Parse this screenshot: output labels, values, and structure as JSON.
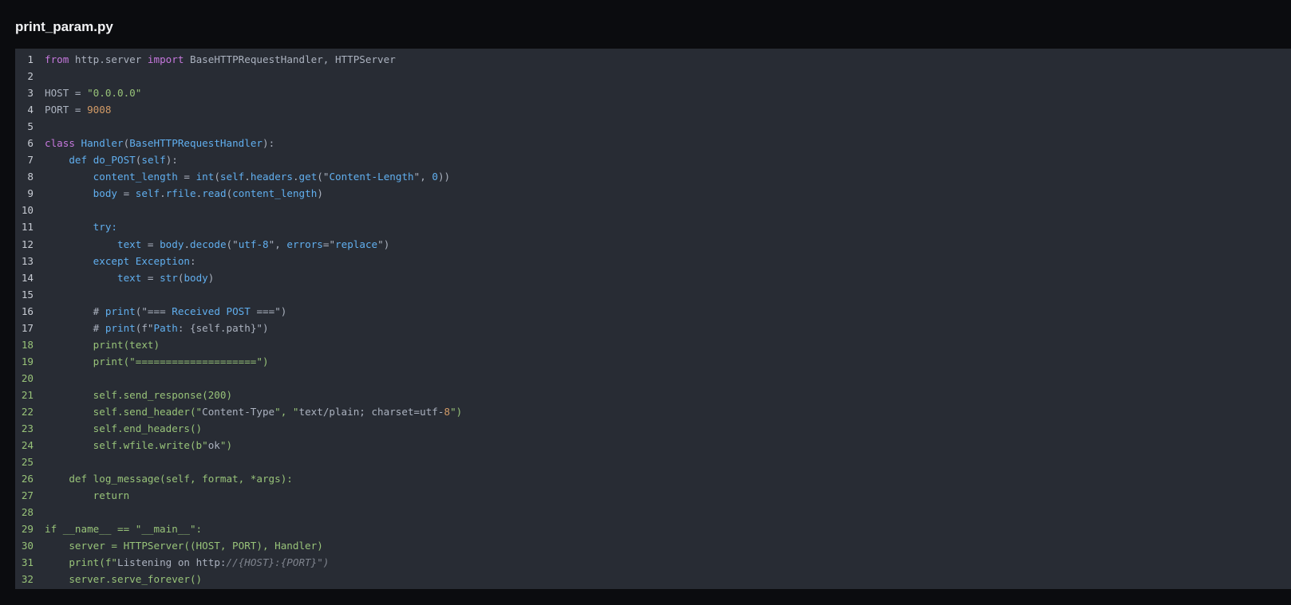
{
  "file": {
    "title": "print_param.py"
  },
  "colors": {
    "page_bg": "#0b0c0f",
    "panel_bg": "#282c34",
    "keyword": "#c678dd",
    "blue": "#61afef",
    "green": "#98c379",
    "orange": "#d19a66",
    "plain": "#abb2bf",
    "comment": "#7f848e"
  },
  "code": {
    "lines": [
      {
        "num": "1",
        "tokens": [
          {
            "t": "from",
            "c": "kw"
          },
          {
            "t": " http.server ",
            "c": "pl"
          },
          {
            "t": "import",
            "c": "kw"
          },
          {
            "t": " BaseHTTPRequestHandler, HTTPServer",
            "c": "pl"
          }
        ]
      },
      {
        "num": "2",
        "tokens": []
      },
      {
        "num": "3",
        "tokens": [
          {
            "t": "HOST = ",
            "c": "pl"
          },
          {
            "t": "\"0.0.0.0\"",
            "c": "gr"
          }
        ]
      },
      {
        "num": "4",
        "tokens": [
          {
            "t": "PORT = ",
            "c": "pl"
          },
          {
            "t": "9008",
            "c": "or"
          }
        ]
      },
      {
        "num": "5",
        "tokens": []
      },
      {
        "num": "6",
        "tokens": [
          {
            "t": "class",
            "c": "kw"
          },
          {
            "t": " ",
            "c": "pl"
          },
          {
            "t": "Handler",
            "c": "bl"
          },
          {
            "t": "(",
            "c": "pl"
          },
          {
            "t": "BaseHTTPRequestHandler",
            "c": "bl"
          },
          {
            "t": "):",
            "c": "pl"
          }
        ]
      },
      {
        "num": "7",
        "tokens": [
          {
            "t": "    ",
            "c": "pl"
          },
          {
            "t": "def",
            "c": "bl"
          },
          {
            "t": " ",
            "c": "pl"
          },
          {
            "t": "do_POST",
            "c": "bl"
          },
          {
            "t": "(",
            "c": "pl"
          },
          {
            "t": "self",
            "c": "bl"
          },
          {
            "t": "):",
            "c": "pl"
          }
        ]
      },
      {
        "num": "8",
        "tokens": [
          {
            "t": "        ",
            "c": "pl"
          },
          {
            "t": "content_length",
            "c": "bl"
          },
          {
            "t": " = ",
            "c": "pl"
          },
          {
            "t": "int",
            "c": "bl"
          },
          {
            "t": "(",
            "c": "pl"
          },
          {
            "t": "self",
            "c": "bl"
          },
          {
            "t": ".",
            "c": "pl"
          },
          {
            "t": "headers",
            "c": "bl"
          },
          {
            "t": ".",
            "c": "pl"
          },
          {
            "t": "get",
            "c": "bl"
          },
          {
            "t": "(\"",
            "c": "pl"
          },
          {
            "t": "Content-Length",
            "c": "bl"
          },
          {
            "t": "\", ",
            "c": "pl"
          },
          {
            "t": "0",
            "c": "bl"
          },
          {
            "t": "))",
            "c": "pl"
          }
        ]
      },
      {
        "num": "9",
        "tokens": [
          {
            "t": "        ",
            "c": "pl"
          },
          {
            "t": "body",
            "c": "bl"
          },
          {
            "t": " = ",
            "c": "pl"
          },
          {
            "t": "self",
            "c": "bl"
          },
          {
            "t": ".",
            "c": "pl"
          },
          {
            "t": "rfile",
            "c": "bl"
          },
          {
            "t": ".",
            "c": "pl"
          },
          {
            "t": "read",
            "c": "bl"
          },
          {
            "t": "(",
            "c": "pl"
          },
          {
            "t": "content_length",
            "c": "bl"
          },
          {
            "t": ")",
            "c": "pl"
          }
        ]
      },
      {
        "num": "10",
        "tokens": []
      },
      {
        "num": "11",
        "tokens": [
          {
            "t": "        ",
            "c": "pl"
          },
          {
            "t": "try:",
            "c": "bl"
          }
        ]
      },
      {
        "num": "12",
        "tokens": [
          {
            "t": "            ",
            "c": "pl"
          },
          {
            "t": "text",
            "c": "bl"
          },
          {
            "t": " = ",
            "c": "pl"
          },
          {
            "t": "body",
            "c": "bl"
          },
          {
            "t": ".",
            "c": "pl"
          },
          {
            "t": "decode",
            "c": "bl"
          },
          {
            "t": "(\"",
            "c": "pl"
          },
          {
            "t": "utf-8",
            "c": "bl"
          },
          {
            "t": "\", ",
            "c": "pl"
          },
          {
            "t": "errors",
            "c": "bl"
          },
          {
            "t": "=\"",
            "c": "pl"
          },
          {
            "t": "replace",
            "c": "bl"
          },
          {
            "t": "\")",
            "c": "pl"
          }
        ]
      },
      {
        "num": "13",
        "tokens": [
          {
            "t": "        ",
            "c": "pl"
          },
          {
            "t": "except",
            "c": "bl"
          },
          {
            "t": " ",
            "c": "pl"
          },
          {
            "t": "Exception",
            "c": "bl"
          },
          {
            "t": ":",
            "c": "pl"
          }
        ]
      },
      {
        "num": "14",
        "tokens": [
          {
            "t": "            ",
            "c": "pl"
          },
          {
            "t": "text",
            "c": "bl"
          },
          {
            "t": " = ",
            "c": "pl"
          },
          {
            "t": "str",
            "c": "bl"
          },
          {
            "t": "(",
            "c": "pl"
          },
          {
            "t": "body",
            "c": "bl"
          },
          {
            "t": ")",
            "c": "pl"
          }
        ]
      },
      {
        "num": "15",
        "tokens": []
      },
      {
        "num": "16",
        "tokens": [
          {
            "t": "        # ",
            "c": "pl"
          },
          {
            "t": "print",
            "c": "bl"
          },
          {
            "t": "(\"=== ",
            "c": "pl"
          },
          {
            "t": "Received",
            "c": "bl"
          },
          {
            "t": " ",
            "c": "pl"
          },
          {
            "t": "POST",
            "c": "bl"
          },
          {
            "t": " ===\")",
            "c": "pl"
          }
        ]
      },
      {
        "num": "17",
        "tokens": [
          {
            "t": "        # ",
            "c": "pl"
          },
          {
            "t": "print",
            "c": "bl"
          },
          {
            "t": "(f\"",
            "c": "pl"
          },
          {
            "t": "Path",
            "c": "bl"
          },
          {
            "t": ": {self.path}\")",
            "c": "pl"
          }
        ]
      },
      {
        "num": "18",
        "alt": true,
        "tokens": [
          {
            "t": "        print(text)",
            "c": "gr"
          }
        ]
      },
      {
        "num": "19",
        "alt": true,
        "tokens": [
          {
            "t": "        print(\"",
            "c": "gr"
          },
          {
            "t": "====================",
            "c": "gr"
          },
          {
            "t": "\")",
            "c": "gr"
          }
        ]
      },
      {
        "num": "20",
        "alt": true,
        "tokens": []
      },
      {
        "num": "21",
        "alt": true,
        "tokens": [
          {
            "t": "        self.send_response(200)",
            "c": "gr"
          }
        ]
      },
      {
        "num": "22",
        "alt": true,
        "tokens": [
          {
            "t": "        self.send_header(\"",
            "c": "gr"
          },
          {
            "t": "Content-Type",
            "c": "pl"
          },
          {
            "t": "\", \"",
            "c": "gr"
          },
          {
            "t": "text/plain; charset=utf-",
            "c": "pl"
          },
          {
            "t": "8",
            "c": "or"
          },
          {
            "t": "\")",
            "c": "gr"
          }
        ]
      },
      {
        "num": "23",
        "alt": true,
        "tokens": [
          {
            "t": "        self.end_headers()",
            "c": "gr"
          }
        ]
      },
      {
        "num": "24",
        "alt": true,
        "tokens": [
          {
            "t": "        self.wfile.write(b\"",
            "c": "gr"
          },
          {
            "t": "ok",
            "c": "pl"
          },
          {
            "t": "\")",
            "c": "gr"
          }
        ]
      },
      {
        "num": "25",
        "alt": true,
        "tokens": []
      },
      {
        "num": "26",
        "alt": true,
        "tokens": [
          {
            "t": "    def log_message(self, format, *args):",
            "c": "gr"
          }
        ]
      },
      {
        "num": "27",
        "alt": true,
        "tokens": [
          {
            "t": "        return",
            "c": "gr"
          }
        ]
      },
      {
        "num": "28",
        "alt": true,
        "tokens": []
      },
      {
        "num": "29",
        "alt": true,
        "tokens": [
          {
            "t": "if __name__ == \"__main__\":",
            "c": "gr"
          }
        ]
      },
      {
        "num": "30",
        "alt": true,
        "tokens": [
          {
            "t": "    server = HTTPServer((HOST, PORT), Handler)",
            "c": "gr"
          }
        ]
      },
      {
        "num": "31",
        "alt": true,
        "tokens": [
          {
            "t": "    print(f\"",
            "c": "gr"
          },
          {
            "t": "Listening on http:",
            "c": "pl"
          },
          {
            "t": "//{HOST}:{PORT}\")",
            "c": "dim"
          }
        ]
      },
      {
        "num": "32",
        "alt": true,
        "tokens": [
          {
            "t": "    server.serve_forever()",
            "c": "gr"
          }
        ]
      }
    ]
  }
}
